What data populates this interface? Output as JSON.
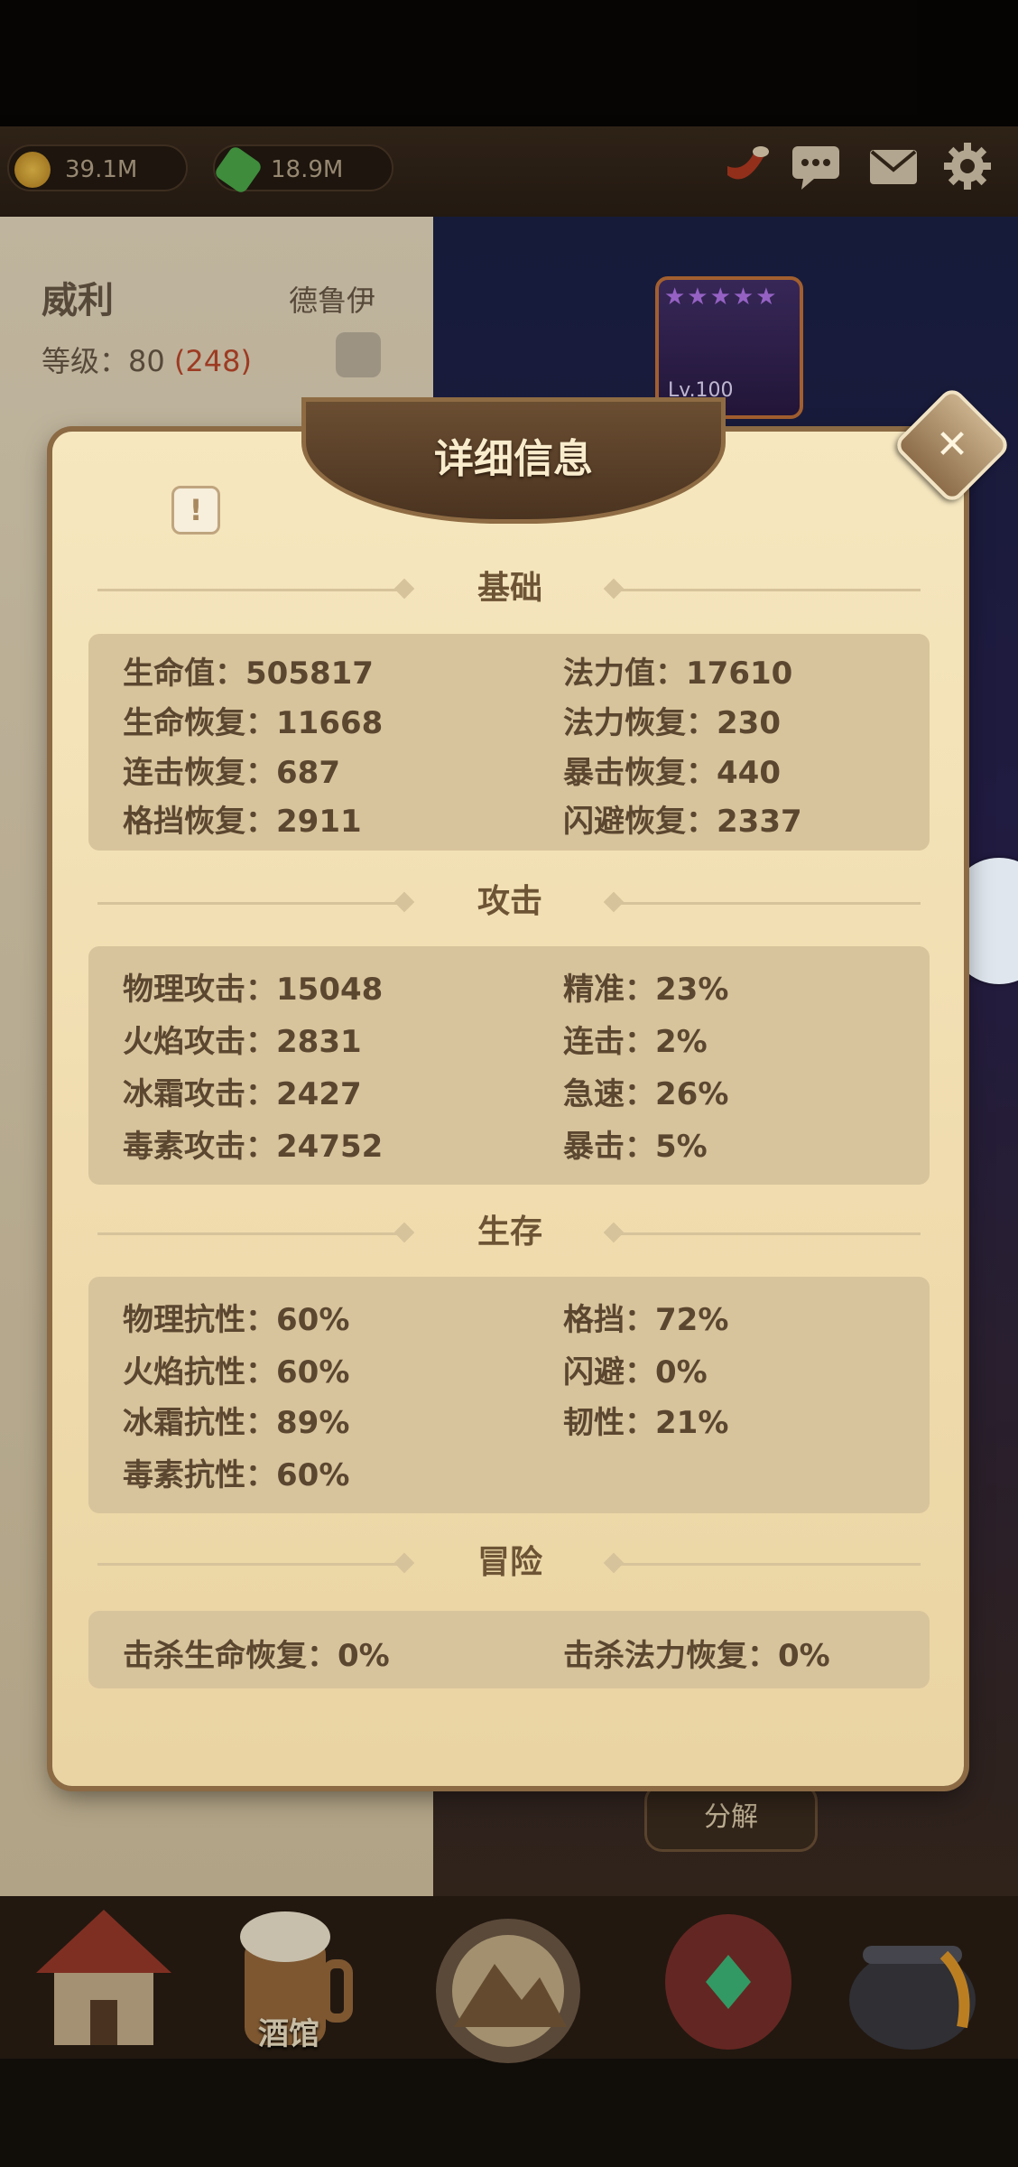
{
  "currencies": {
    "gold": "39.1M",
    "gems": "18.9M"
  },
  "hero": {
    "name": "威利",
    "class": "德鲁伊",
    "level_label": "等级：",
    "level_value": "80",
    "level_extra": "(248)",
    "card_level": "Lv.100"
  },
  "dialog": {
    "title": "详细信息",
    "info_glyph": "!",
    "close_glyph": "✕",
    "sections": [
      {
        "title": "基础",
        "rows": [
          [
            "生命值：505817",
            "法力值：17610"
          ],
          [
            "生命恢复：11668",
            "法力恢复：230"
          ],
          [
            "连击恢复：687",
            "暴击恢复：440"
          ],
          [
            "格挡恢复：2911",
            "闪避恢复：2337"
          ]
        ]
      },
      {
        "title": "攻击",
        "rows": [
          [
            "物理攻击：15048",
            "精准：23%"
          ],
          [
            "火焰攻击：2831",
            "连击：2%"
          ],
          [
            "冰霜攻击：2427",
            "急速：26%"
          ],
          [
            "毒素攻击：24752",
            "暴击：5%"
          ]
        ]
      },
      {
        "title": "生存",
        "rows": [
          [
            "物理抗性：60%",
            "格挡：72%"
          ],
          [
            "火焰抗性：60%",
            "闪避：0%"
          ],
          [
            "冰霜抗性：89%",
            "韧性：21%"
          ],
          [
            "毒素抗性：60%",
            ""
          ]
        ]
      },
      {
        "title": "冒险",
        "rows": [
          [
            "击杀生命恢复：0%",
            "击杀法力恢复：0%"
          ]
        ]
      }
    ]
  },
  "buttons": {
    "decompose": "分解"
  },
  "nav": {
    "tavern_label": "酒馆"
  },
  "colors": {
    "parchment": "#f3e2b6",
    "stat_box": "#d8c49c",
    "banner": "#5a3f28",
    "accent_red": "#c0492b"
  },
  "icons": [
    "coin-icon",
    "gem-icon",
    "horn-icon",
    "chat-icon",
    "mail-icon",
    "gear-icon",
    "close-icon",
    "info-icon",
    "house-icon",
    "tavern-icon",
    "adventure-icon",
    "chest-icon",
    "cauldron-icon"
  ]
}
